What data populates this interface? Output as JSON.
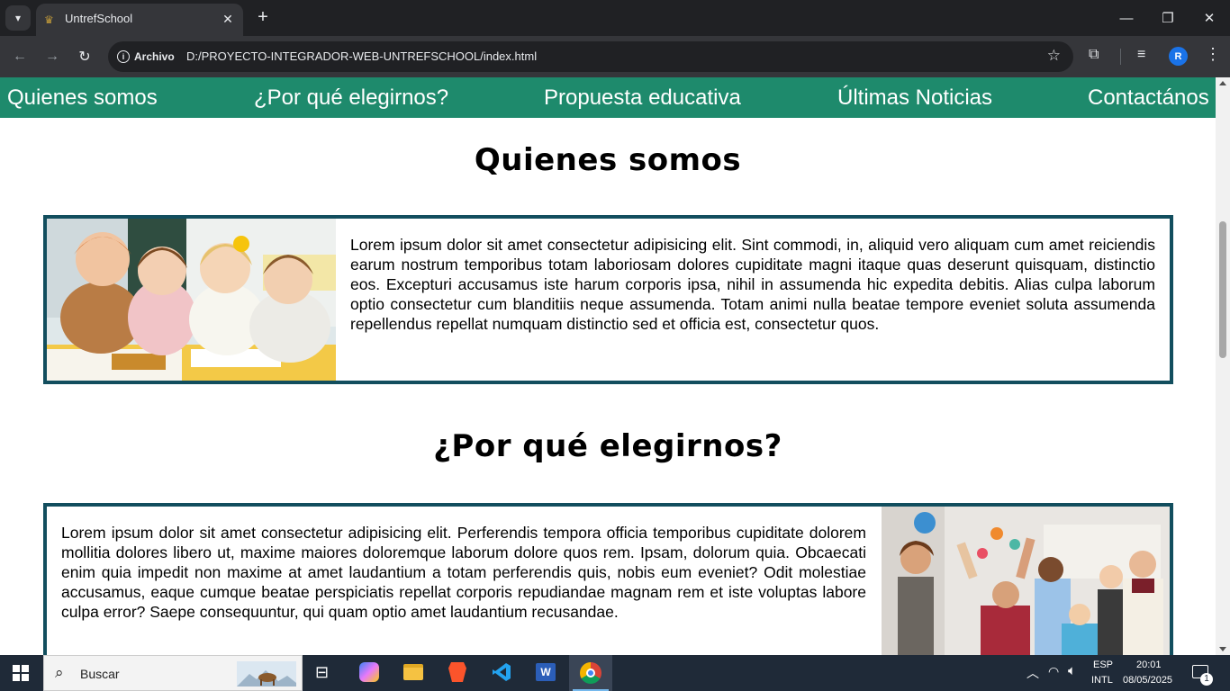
{
  "browser": {
    "tab_title": "UntrefSchool",
    "tab_close": "✕",
    "new_tab": "+",
    "site_chip_label": "Archivo",
    "url": "D:/PROYECTO-INTEGRADOR-WEB-UNTREFSCHOOL/index.html",
    "profile_initial": "R",
    "window_controls": {
      "minimize": "—",
      "restore": "❐",
      "close": "✕"
    }
  },
  "site_nav": {
    "items": [
      "Quienes somos",
      "¿Por qué elegirnos?",
      "Propuesta educativa",
      "Últimas Noticias",
      "Contactános"
    ],
    "background": "#1e8a6c"
  },
  "sections": [
    {
      "title": "Quienes somos",
      "text": "Lorem ipsum dolor sit amet consectetur adipisicing elit. Sint commodi, in, aliquid vero aliquam cum amet reiciendis earum nostrum temporibus totam laboriosam dolores cupiditate magni itaque quas deserunt quisquam, distinctio eos. Excepturi accusamus iste harum corporis ipsa, nihil in assumenda hic expedita debitis. Alias culpa laborum optio consectetur cum blanditiis neque assumenda. Totam animi nulla beatae tempore eveniet soluta assumenda repellendus repellat numquam distinctio sed et officia est, consectetur quos.",
      "image": "children-smiling-at-desk-photo"
    },
    {
      "title": "¿Por qué elegirnos?",
      "text": "Lorem ipsum dolor sit amet consectetur adipisicing elit. Perferendis tempora officia temporibus cupiditate dolorem mollitia dolores libero ut, maxime maiores doloremque laborum dolore quos rem. Ipsam, dolorum quia. Obcaecati enim quia impedit non maxime at amet laudantium a totam perferendis quis, nobis eum eveniet? Odit molestiae accusamus, eaque cumque beatae perspiciatis repellat corporis repudiandae magnam rem et iste voluptas labore culpa error? Saepe consequuntur, qui quam optio amet laudantium recusandae.",
      "image": "students-raising-hands-classroom-photo"
    }
  ],
  "card_border_color": "#124e5e",
  "taskbar": {
    "search_placeholder": "Buscar",
    "language": "ESP",
    "layout": "INTL",
    "time": "20:01",
    "date": "08/05/2025",
    "notification_count": "1",
    "apps": [
      "task-view-icon",
      "copilot-icon",
      "file-explorer-icon",
      "brave-icon",
      "vscode-icon",
      "word-icon",
      "chrome-icon"
    ]
  }
}
